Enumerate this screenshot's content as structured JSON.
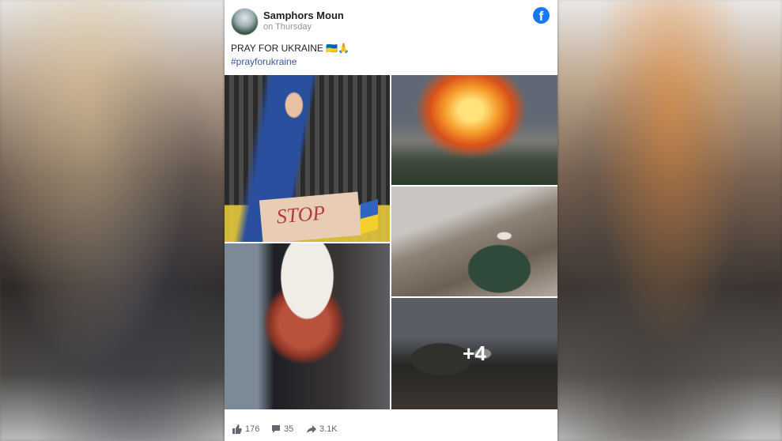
{
  "post": {
    "author": "Samphors Moun",
    "time": "on Thursday",
    "text": "PRAY FOR UKRAINE 🇺🇦🙏",
    "hashtag": "#prayforukraine",
    "more_photos": "+4"
  },
  "stats": {
    "likes": "176",
    "comments": "35",
    "shares": "3.1K"
  },
  "icons": [
    "facebook-icon",
    "like-icon",
    "comment-icon",
    "share-icon"
  ],
  "colors": {
    "brand": "#1877f2",
    "hashtag": "#385898"
  }
}
